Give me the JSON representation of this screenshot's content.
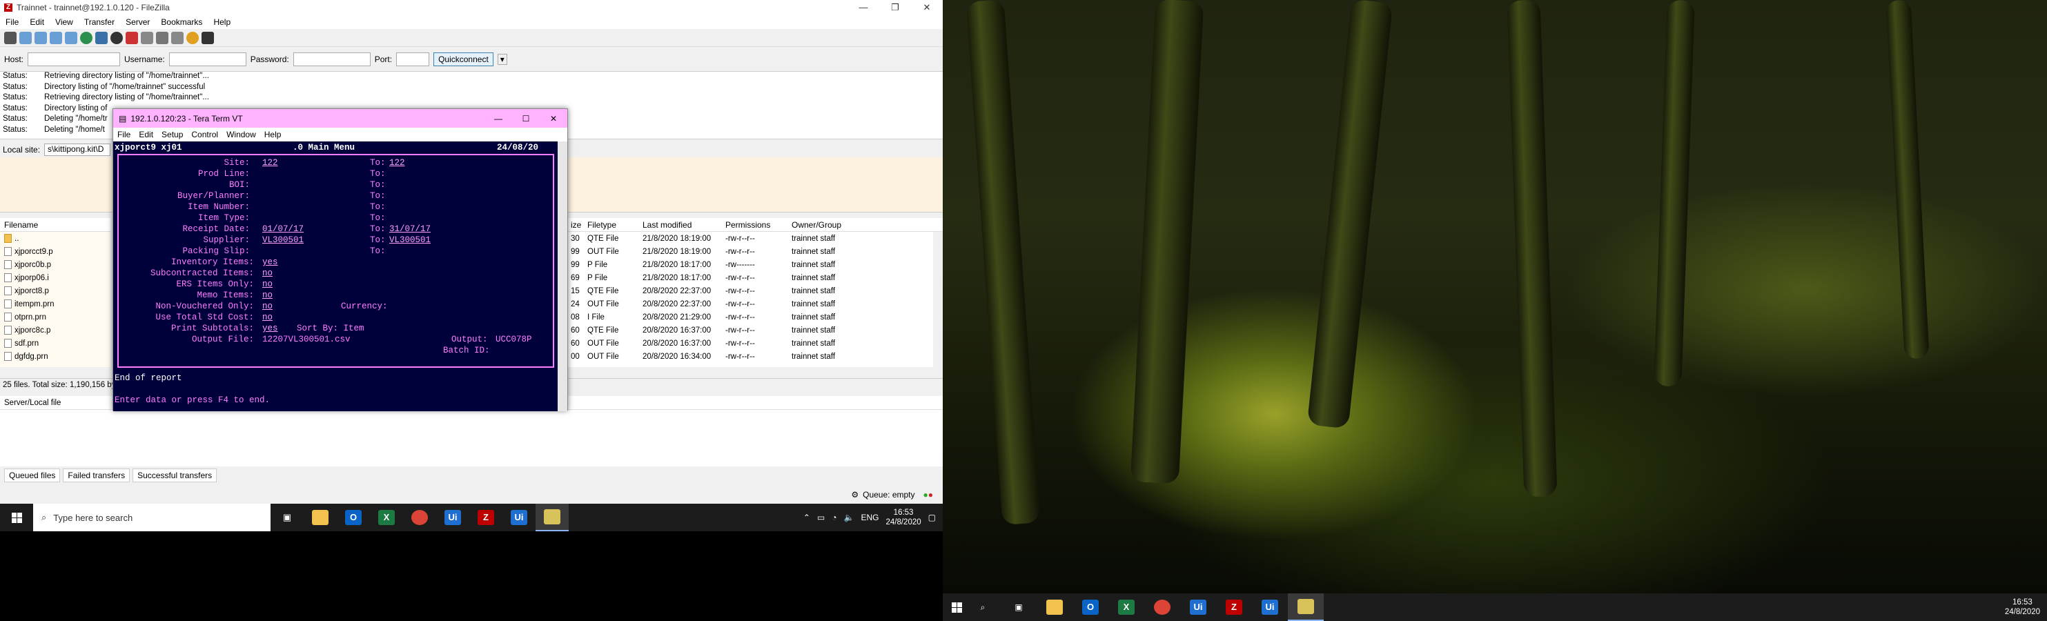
{
  "filezilla": {
    "title": "Trainnet - trainnet@192.1.0.120 - FileZilla",
    "menu": [
      "File",
      "Edit",
      "View",
      "Transfer",
      "Server",
      "Bookmarks",
      "Help"
    ],
    "quickconnect": {
      "host_label": "Host:",
      "user_label": "Username:",
      "pass_label": "Password:",
      "port_label": "Port:",
      "button": "Quickconnect"
    },
    "log": [
      {
        "k": "Status:",
        "v": "Retrieving directory listing of \"/home/trainnet\"..."
      },
      {
        "k": "Status:",
        "v": "Directory listing of \"/home/trainnet\" successful"
      },
      {
        "k": "Status:",
        "v": "Retrieving directory listing of \"/home/trainnet\"..."
      },
      {
        "k": "Status:",
        "v": "Directory listing of"
      },
      {
        "k": "Status:",
        "v": "Deleting \"/home/tr"
      },
      {
        "k": "Status:",
        "v": "Deleting \"/home/t"
      }
    ],
    "local_site_label": "Local site:",
    "local_site_value": "s\\kittipong.kit\\D",
    "left_header": "Filename",
    "left_files": [
      "..",
      "xjporcct9.p",
      "xjporc0b.p",
      "xjporp06.i",
      "xjporct8.p",
      "itempm.prn",
      "otprn.prn",
      "xjporc8c.p",
      "sdf.prn",
      "dgfdg.prn"
    ],
    "left_status": "25 files. Total size: 1,190,156 by",
    "right_headers": [
      "ize",
      "Filetype",
      "Last modified",
      "Permissions",
      "Owner/Group"
    ],
    "right_rows": [
      [
        "30",
        "QTE File",
        "21/8/2020 18:19:00",
        "-rw-r--r--",
        "trainnet staff"
      ],
      [
        "99",
        "OUT File",
        "21/8/2020 18:19:00",
        "-rw-r--r--",
        "trainnet staff"
      ],
      [
        "99",
        "P File",
        "21/8/2020 18:17:00",
        "-rw-------",
        "trainnet staff"
      ],
      [
        "69",
        "P File",
        "21/8/2020 18:17:00",
        "-rw-r--r--",
        "trainnet staff"
      ],
      [
        "15",
        "QTE File",
        "20/8/2020 22:37:00",
        "-rw-r--r--",
        "trainnet staff"
      ],
      [
        "24",
        "OUT File",
        "20/8/2020 22:37:00",
        "-rw-r--r--",
        "trainnet staff"
      ],
      [
        "08",
        "I File",
        "20/8/2020 21:29:00",
        "-rw-r--r--",
        "trainnet staff"
      ],
      [
        "60",
        "QTE File",
        "20/8/2020 16:37:00",
        "-rw-r--r--",
        "trainnet staff"
      ],
      [
        "60",
        "OUT File",
        "20/8/2020 16:37:00",
        "-rw-r--r--",
        "trainnet staff"
      ],
      [
        "00",
        "OUT File",
        "20/8/2020 16:34:00",
        "-rw-r--r--",
        "trainnet staff"
      ]
    ],
    "queue_header": "Server/Local file",
    "tabs": [
      "Queued files",
      "Failed transfers",
      "Successful transfers"
    ],
    "queue_status": "Queue: empty"
  },
  "teraterm": {
    "title": "192.1.0.120:23 - Tera Term VT",
    "menu": [
      "File",
      "Edit",
      "Setup",
      "Control",
      "Window",
      "Help"
    ],
    "header_left": "xjporct9 xj01",
    "header_mid": ".0 Main Menu",
    "header_right": "24/08/20",
    "site_label": "Site:",
    "site_from": "122",
    "site_to_label": "To:",
    "site_to": "122",
    "prod_line": "Prod Line:",
    "bol": "BOI:",
    "buyer": "Buyer/Planner:",
    "item_number": "Item Number:",
    "item_type": "Item Type:",
    "receipt_date": "Receipt Date:",
    "receipt_from": "01/07/17",
    "receipt_to": "31/07/17",
    "supplier": "Supplier:",
    "supplier_from": "VL300501",
    "supplier_to": "VL300501",
    "packing_slip": "Packing Slip:",
    "to": "To:",
    "inventory": "Inventory Items:",
    "inventory_val": "yes",
    "subcontract": "Subcontracted Items:",
    "subcontract_val": "no",
    "ers": "ERS Items Only:",
    "ers_val": "no",
    "memo": "Memo Items:",
    "memo_val": "no",
    "nonvouch": "Non-Vouchered Only:",
    "nonvouch_val": "no",
    "currency": "Currency:",
    "stdcost": "Use Total Std Cost:",
    "stdcost_val": "no",
    "print_sub": "Print Subtotals:",
    "print_sub_val": "yes",
    "sort_by": "Sort By: Item",
    "output_file": "Output File:",
    "output_file_val": "12207VL300501.csv",
    "output": "Output:",
    "output_val": "UCC078P",
    "batch": "Batch ID:",
    "end": "End of report",
    "prompt": "Enter data or press F4 to end."
  },
  "taskbar": {
    "search_placeholder": "Type here to search",
    "lang": "ENG",
    "time": "16:53",
    "date": "24/8/2020"
  }
}
